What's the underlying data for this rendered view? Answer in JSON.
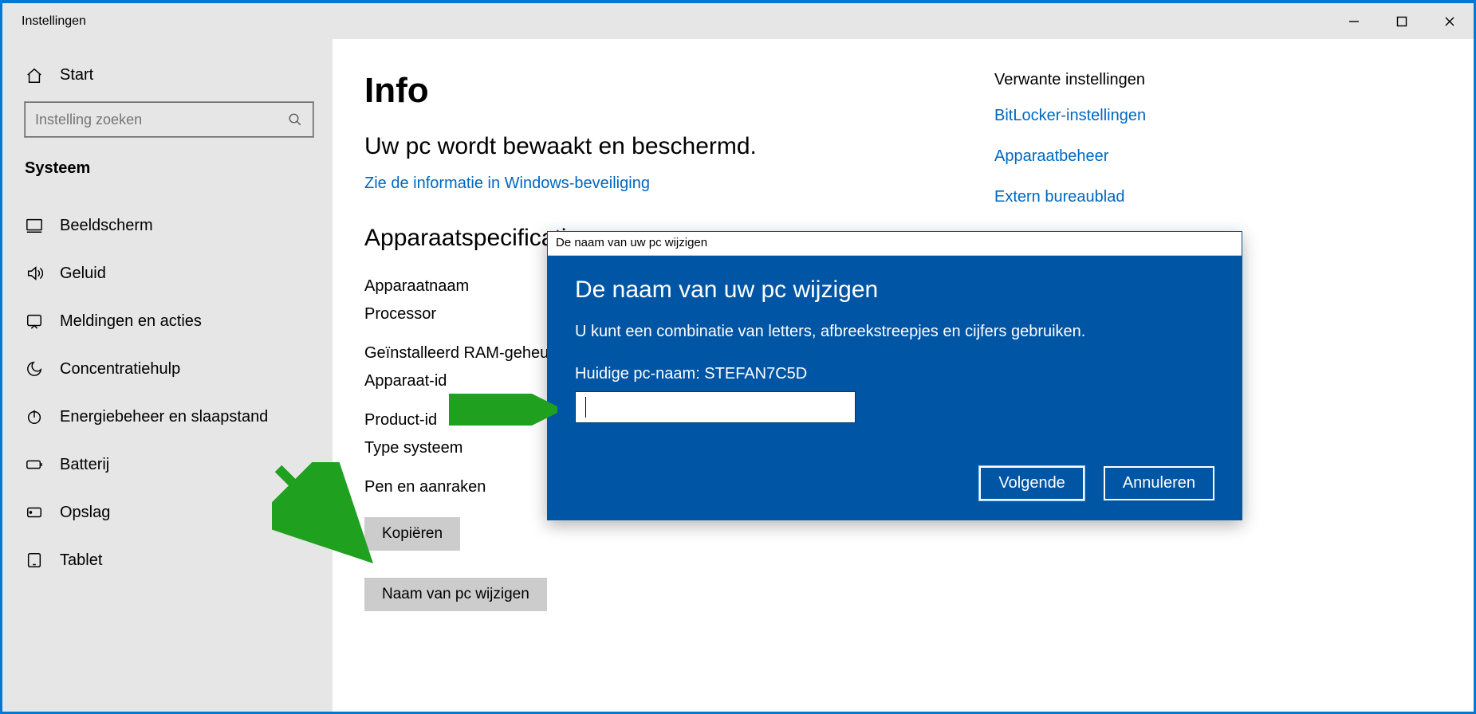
{
  "window": {
    "title": "Instellingen"
  },
  "sidebar": {
    "home": "Start",
    "search_placeholder": "Instelling zoeken",
    "category": "Systeem",
    "items": [
      {
        "icon": "display",
        "label": "Beeldscherm"
      },
      {
        "icon": "sound",
        "label": "Geluid"
      },
      {
        "icon": "notif",
        "label": "Meldingen en acties"
      },
      {
        "icon": "moon",
        "label": "Concentratiehulp"
      },
      {
        "icon": "power",
        "label": "Energiebeheer en slaapstand"
      },
      {
        "icon": "battery",
        "label": "Batterij"
      },
      {
        "icon": "storage",
        "label": "Opslag"
      },
      {
        "icon": "tablet",
        "label": "Tablet"
      }
    ]
  },
  "main": {
    "heading": "Info",
    "subheading": "Uw pc wordt bewaakt en beschermd.",
    "security_link": "Zie de informatie in Windows-beveiliging",
    "specs_heading": "Apparaatspecificaties",
    "specs": {
      "device_name": "Apparaatnaam",
      "processor": "Processor",
      "ram": "Geïnstalleerd RAM-geheugen",
      "device_id": "Apparaat-id",
      "product_id": "Product-id",
      "system_type": "Type systeem",
      "pen_touch": "Pen en aanraken"
    },
    "copy_button": "Kopiëren",
    "rename_button": "Naam van pc wijzigen"
  },
  "related": {
    "heading": "Verwante instellingen",
    "links": [
      "BitLocker-instellingen",
      "Apparaatbeheer",
      "Extern bureaublad"
    ]
  },
  "dialog": {
    "titlebar": "De naam van uw pc wijzigen",
    "heading": "De naam van uw pc wijzigen",
    "description": "U kunt een combinatie van letters, afbreekstreepjes en cijfers gebruiken.",
    "current_label": "Huidige pc-naam: STEFAN7C5D",
    "input_value": "",
    "next": "Volgende",
    "cancel": "Annuleren"
  },
  "annotations": {
    "arrow_color": "#1fa01f"
  }
}
